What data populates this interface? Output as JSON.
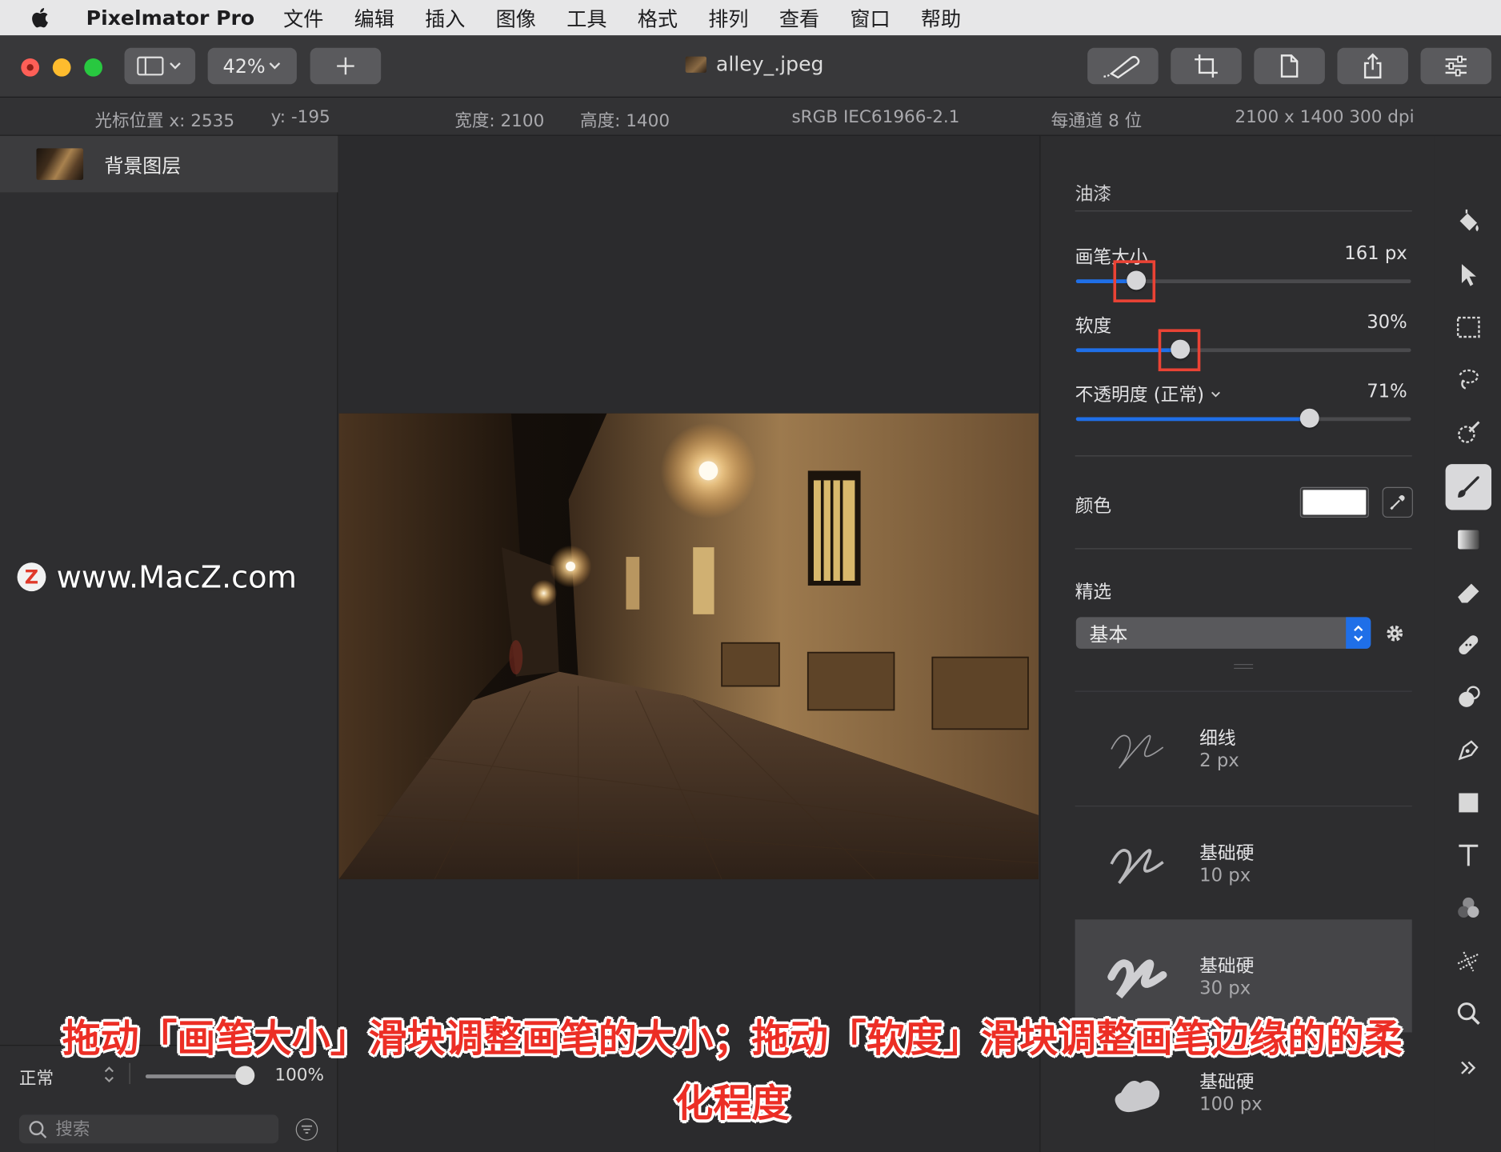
{
  "menubar": {
    "app_name": "Pixelmator Pro",
    "items": [
      "文件",
      "编辑",
      "插入",
      "图像",
      "工具",
      "格式",
      "排列",
      "查看",
      "窗口",
      "帮助"
    ]
  },
  "toolbar": {
    "zoom": "42%",
    "add_label": "+",
    "document_title": "alley_.jpeg",
    "icons": [
      "sidebar-toggle-icon",
      "brush-tool-icon",
      "crop-icon",
      "document-icon",
      "share-icon",
      "adjustments-icon"
    ]
  },
  "infobar": {
    "cursor_label": "光标位置 x: 2535",
    "cursor_y": "y: -195",
    "width": "宽度: 2100",
    "height": "高度: 1400",
    "color_profile": "sRGB IEC61966-2.1",
    "bit_depth": "每通道 8 位",
    "dimensions": "2100 x 1400 300 dpi"
  },
  "layers": {
    "items": [
      {
        "name": "背景图层"
      }
    ],
    "blend_mode": "正常",
    "opacity": "100%",
    "opacity_fraction": 1.0,
    "search_placeholder": "搜索"
  },
  "watermark": {
    "text": "www.MacZ.com",
    "logo_letter": "Z"
  },
  "settings": {
    "section_title": "油漆",
    "brush_size_label": "画笔大小",
    "brush_size_value": "161 px",
    "brush_size_fraction": 0.18,
    "softness_label": "软度",
    "softness_value": "30%",
    "softness_fraction": 0.31,
    "opacity_label": "不透明度 (正常)",
    "opacity_value": "71%",
    "opacity_fraction": 0.696,
    "color_label": "颜色",
    "color_value": "#ffffff",
    "presets_label": "精选",
    "presets_selected": "基本",
    "accent_color": "#1f6fe8",
    "brushes": [
      {
        "name": "细线",
        "size": "2 px"
      },
      {
        "name": "基础硬",
        "size": "10 px"
      },
      {
        "name": "基础硬",
        "size": "30 px"
      },
      {
        "name": "基础硬",
        "size": "100 px"
      }
    ]
  },
  "tools": [
    "paint-bucket-icon",
    "arrange-arrow-icon",
    "rectangle-select-icon",
    "lasso-icon",
    "quick-select-icon",
    "paint-brush-icon",
    "gradient-icon",
    "eraser-icon",
    "repair-icon",
    "clone-icon",
    "pen-icon",
    "shape-icon",
    "type-icon",
    "color-adjust-icon",
    "distort-icon",
    "zoom-icon",
    "more-tools-icon"
  ],
  "caption": {
    "line1": "拖动「画笔大小」滑块调整画笔的大小；拖动「软度」滑块调整画笔边缘的的柔",
    "line2": "化程度"
  }
}
